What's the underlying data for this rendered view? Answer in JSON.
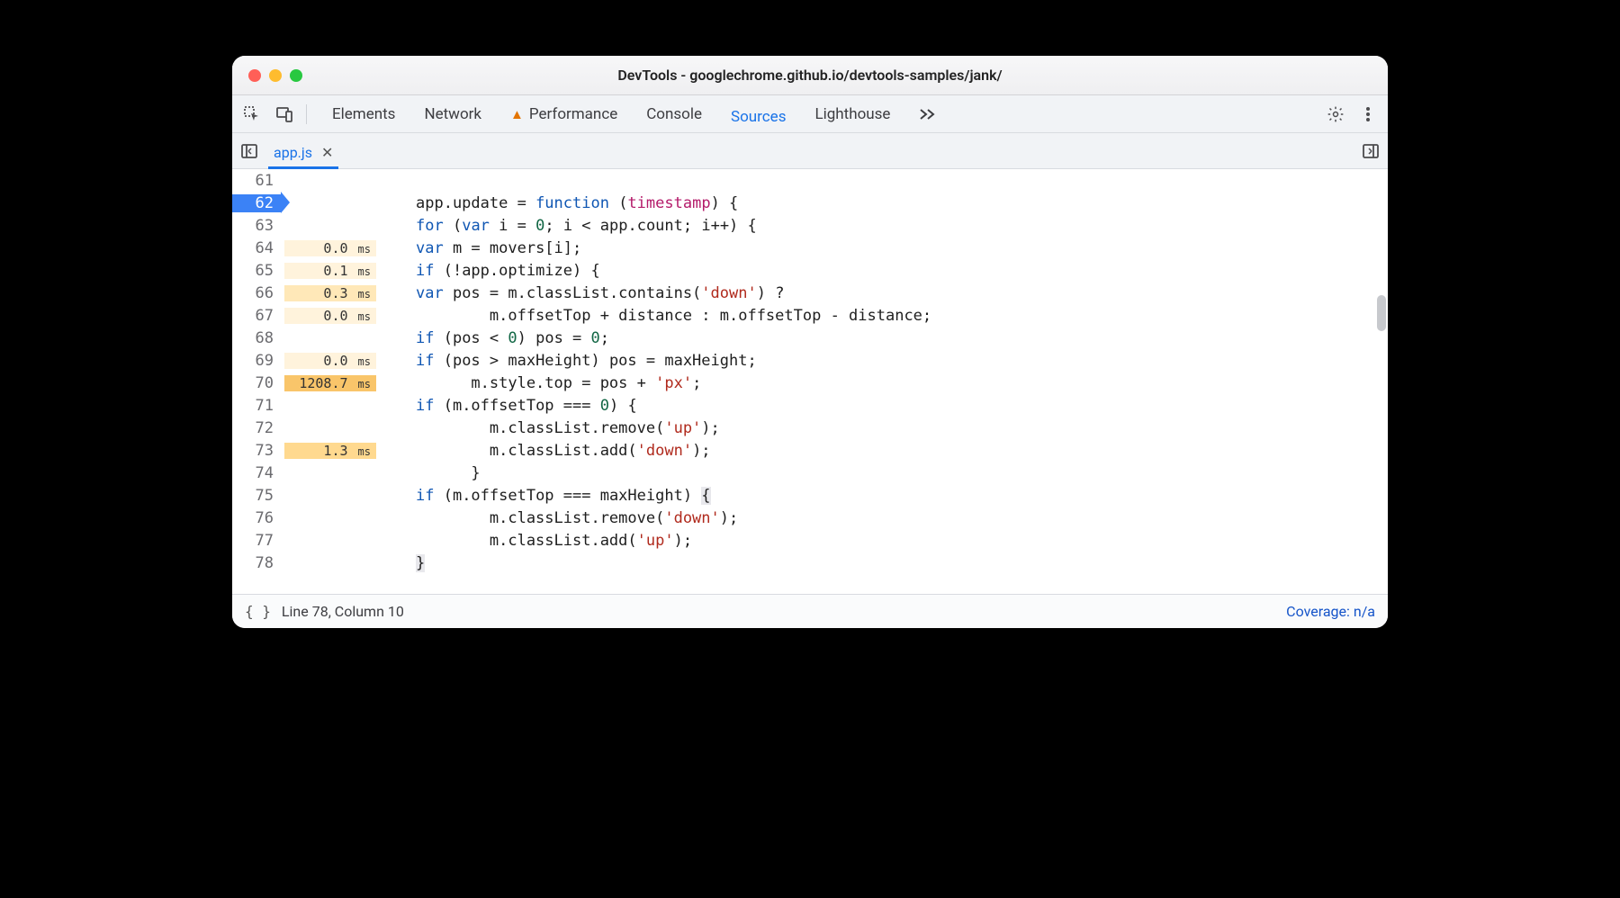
{
  "window": {
    "title": "DevTools - googlechrome.github.io/devtools-samples/jank/"
  },
  "toolbar": {
    "tabs": [
      {
        "label": "Elements",
        "active": false,
        "warn": false
      },
      {
        "label": "Network",
        "active": false,
        "warn": false
      },
      {
        "label": "Performance",
        "active": false,
        "warn": true
      },
      {
        "label": "Console",
        "active": false,
        "warn": false
      },
      {
        "label": "Sources",
        "active": true,
        "warn": false
      },
      {
        "label": "Lighthouse",
        "active": false,
        "warn": false
      }
    ]
  },
  "file_tab": {
    "name": "app.js"
  },
  "gutter": {
    "lines": [
      {
        "n": "61",
        "timing": "",
        "heat": 0,
        "exec": false
      },
      {
        "n": "62",
        "timing": "",
        "heat": 0,
        "exec": true
      },
      {
        "n": "63",
        "timing": "",
        "heat": 0,
        "exec": false
      },
      {
        "n": "64",
        "timing": "0.0",
        "heat": 1,
        "exec": false
      },
      {
        "n": "65",
        "timing": "0.1",
        "heat": 1,
        "exec": false
      },
      {
        "n": "66",
        "timing": "0.3",
        "heat": 2,
        "exec": false
      },
      {
        "n": "67",
        "timing": "0.0",
        "heat": 1,
        "exec": false
      },
      {
        "n": "68",
        "timing": "",
        "heat": 0,
        "exec": false
      },
      {
        "n": "69",
        "timing": "0.0",
        "heat": 1,
        "exec": false
      },
      {
        "n": "70",
        "timing": "1208.7",
        "heat": 4,
        "exec": false
      },
      {
        "n": "71",
        "timing": "",
        "heat": 0,
        "exec": false
      },
      {
        "n": "72",
        "timing": "",
        "heat": 0,
        "exec": false
      },
      {
        "n": "73",
        "timing": "1.3",
        "heat": 3,
        "exec": false
      },
      {
        "n": "74",
        "timing": "",
        "heat": 0,
        "exec": false
      },
      {
        "n": "75",
        "timing": "",
        "heat": 0,
        "exec": false
      },
      {
        "n": "76",
        "timing": "",
        "heat": 0,
        "exec": false
      },
      {
        "n": "77",
        "timing": "",
        "heat": 0,
        "exec": false
      },
      {
        "n": "78",
        "timing": "",
        "heat": 0,
        "exec": false
      }
    ]
  },
  "status": {
    "position": "Line 78, Column 10",
    "coverage": "Coverage: n/a"
  },
  "code": {
    "ms_unit": "ms"
  }
}
